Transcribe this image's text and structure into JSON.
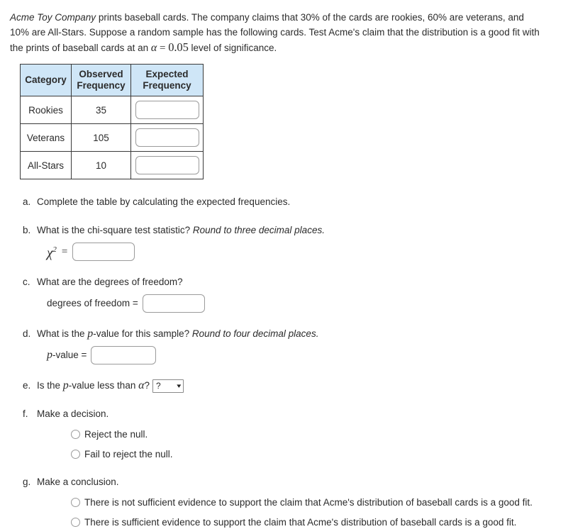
{
  "problem": {
    "company": "Acme Toy Company",
    "text_1": " prints baseball cards. The company claims that 30% of the cards are rookies, 60% are veterans, and 10% are All-Stars. Suppose a random sample has the following cards. Test Acme's claim that the distribution is a good fit with the prints of baseball cards at an ",
    "alpha_symbol": "α",
    "equals": " = ",
    "alpha_value": "0.05",
    "text_2": " level of significance."
  },
  "table": {
    "headers": [
      "Category",
      "Observed Frequency",
      "Expected Frequency"
    ],
    "header_lines": [
      [
        "Category"
      ],
      [
        "Observed",
        "Frequency"
      ],
      [
        "Expected",
        "Frequency"
      ]
    ],
    "rows": [
      {
        "category": "Rookies",
        "observed": "35",
        "expected": ""
      },
      {
        "category": "Veterans",
        "observed": "105",
        "expected": ""
      },
      {
        "category": "All-Stars",
        "observed": "10",
        "expected": ""
      }
    ],
    "header_bg": "#cfe6f7",
    "border_color": "#3a3a3a"
  },
  "questions": {
    "a": {
      "label": "a.",
      "text": "Complete the table by calculating the expected frequencies."
    },
    "b": {
      "label": "b.",
      "text": "What is the chi-square test statistic? ",
      "emphasis": "Round to three decimal places.",
      "symbol": "χ",
      "exponent": "2",
      "equals": "=",
      "value": ""
    },
    "c": {
      "label": "c.",
      "text": "What are the degrees of freedom?",
      "answer_label": "degrees of freedom =",
      "value": ""
    },
    "d": {
      "label": "d.",
      "text_before": "What is the ",
      "p_symbol": "p",
      "text_after": "-value for this sample? ",
      "emphasis": "Round to four decimal places.",
      "answer_p": "p",
      "answer_label": "-value =",
      "value": ""
    },
    "e": {
      "label": "e.",
      "text_before": "Is the ",
      "p_symbol": "p",
      "text_mid": "-value less than ",
      "alpha_symbol": "α",
      "text_after": "?",
      "select_value": "?",
      "caret": "⌄"
    },
    "f": {
      "label": "f.",
      "text": "Make a decision.",
      "options": [
        "Reject the null.",
        "Fail to reject the null."
      ]
    },
    "g": {
      "label": "g.",
      "text": "Make a conclusion.",
      "options": [
        "There is not sufficient evidence to support the claim that Acme's distribution of baseball cards is a good fit.",
        "There is sufficient evidence to support the claim that Acme's distribution of baseball cards is a good fit."
      ]
    }
  }
}
